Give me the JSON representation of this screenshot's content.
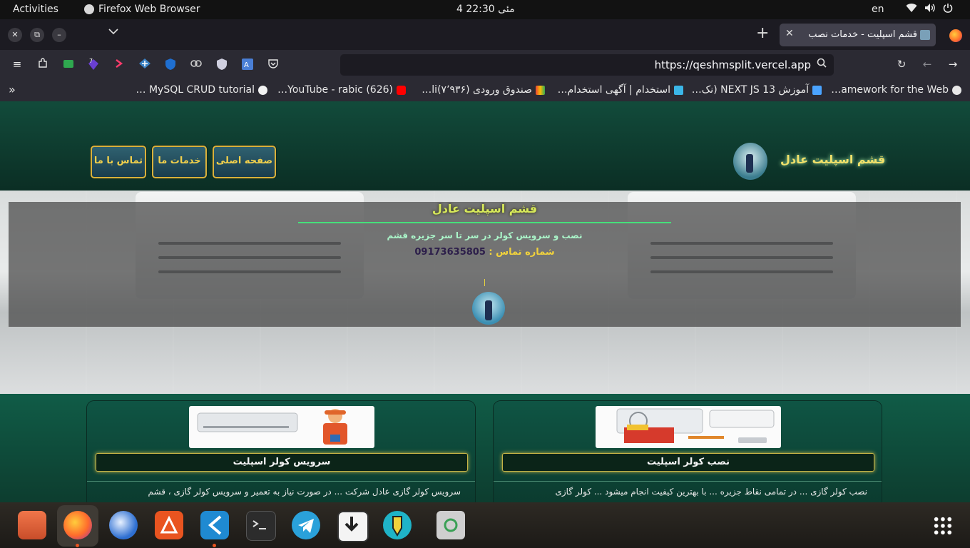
{
  "topbar": {
    "activities": "Activities",
    "app_name": "Firefox Web Browser",
    "clock": "4 مئی  22:30",
    "lang": "en",
    "sys_icons": [
      "wifi-icon",
      "volume-icon",
      "power-icon"
    ]
  },
  "tabs": {
    "active_title": "قشم اسپلیت - خدمات نصب",
    "close_glyph": "✕",
    "new_tab_glyph": "+",
    "list_glyph": "⌄"
  },
  "window_controls": {
    "close": "✕",
    "restore": "⧉",
    "minimize": "–"
  },
  "toolbar": {
    "url": "https://qeshmsplit.vercel.app",
    "badge_count": "7",
    "menu_glyph": "≡",
    "reload_glyph": "↻",
    "back_glyph": "←",
    "forward_glyph": "→",
    "search_glyph": "🔍"
  },
  "bookmarks": [
    {
      "label": "amework for the Web…",
      "icon": "nextjs-icon",
      "color": "#e8e8e8"
    },
    {
      "label": "آموزش NEXT JS 13 (نک…",
      "icon": "windows-icon",
      "color": "#4aa3ff"
    },
    {
      "label": "استخدام | آگهی استخدام…",
      "icon": "jobinja-icon",
      "color": "#3bb6e8"
    },
    {
      "label": "صندوق ورودی (۷٬۹۳۶)li…",
      "icon": "gmail-icon",
      "color": "#ea4335"
    },
    {
      "label": "(626) YouTube - rabic…",
      "icon": "youtube-icon",
      "color": "#ff0000"
    },
    {
      "label": "MySQL CRUD tutorial …",
      "icon": "notion-icon",
      "color": "#f2f2f2"
    }
  ],
  "bookmarks_overflow": "»",
  "site": {
    "brand": "قشم اسپلیت عادل",
    "nav": [
      {
        "label": "صفحه اصلی"
      },
      {
        "label": "خدمات ما"
      },
      {
        "label": "تماس با ما"
      }
    ],
    "hero": {
      "title": "قشم اسپلیت عادل",
      "subtitle": "نصب و سرویس کولر در سر تا سر جزیره قشم",
      "phone_label": "شماره تماس :",
      "phone_number": "09173635805"
    },
    "cards": [
      {
        "title": "سرویس کولر اسپلیت",
        "text": "سرویس کولر گازی عادل شرکت ... در صورت نیاز به تعمیر و سرویس کولر گازی ، قشم"
      },
      {
        "title": "نصب کولر اسپلیت",
        "text": "نصب کولر گازی ... در تمامی نقاط جزیره ... با بهترین کیفیت انجام میشود ... کولر گازی"
      }
    ]
  },
  "dock": {
    "apps": [
      {
        "name": "files",
        "color": "#e0693a"
      },
      {
        "name": "firefox",
        "color": "#ff7139"
      },
      {
        "name": "thunderbird",
        "color": "#2e6fd1"
      },
      {
        "name": "app-center",
        "color": "#e95420"
      },
      {
        "name": "vscode",
        "color": "#1f8ad2"
      },
      {
        "name": "terminal",
        "color": "#2c2c2c"
      },
      {
        "name": "telegram",
        "color": "#2aa1da"
      },
      {
        "name": "downloader",
        "color": "#f4f4f4"
      },
      {
        "name": "pen-app",
        "color": "#1fb3c7"
      },
      {
        "name": "trash",
        "color": "#cfcfcf"
      }
    ]
  }
}
